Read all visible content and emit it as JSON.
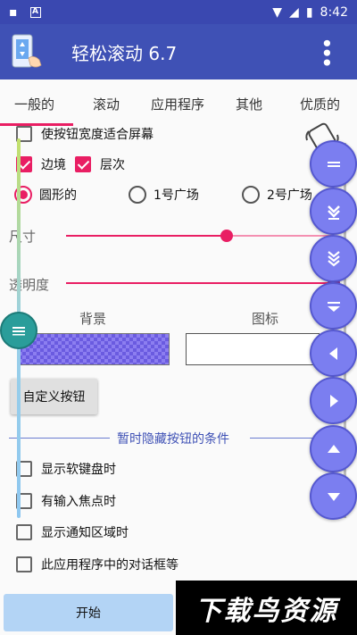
{
  "status": {
    "time": "8:42"
  },
  "app": {
    "title": "轻松滚动 6.7"
  },
  "tabs": [
    "一般的",
    "滚动",
    "应用程序",
    "其他",
    "优质的"
  ],
  "options": {
    "fit_width": "使按钮宽度适合屏幕",
    "border": "边境",
    "layers": "层次",
    "shape_round": "圆形的",
    "shape_square1": "1号广场",
    "shape_square2": "2号广场",
    "size_label": "尺寸",
    "size_value": 0.6,
    "opacity_label": "透明度",
    "opacity_value": 1.0,
    "background_label": "背景",
    "icon_label": "图标",
    "custom_button": "自定义按钮"
  },
  "hide_section": {
    "title": "暂时隐藏按钮的条件",
    "items": [
      "显示软键盘时",
      "有输入焦点时",
      "显示通知区域时",
      "此应用程序中的对话框等"
    ]
  },
  "start_button": "开始",
  "watermark": "下载鸟资源",
  "colors": {
    "primary": "#3f51b5",
    "accent": "#e91e63",
    "float": "#7b7ef0"
  }
}
